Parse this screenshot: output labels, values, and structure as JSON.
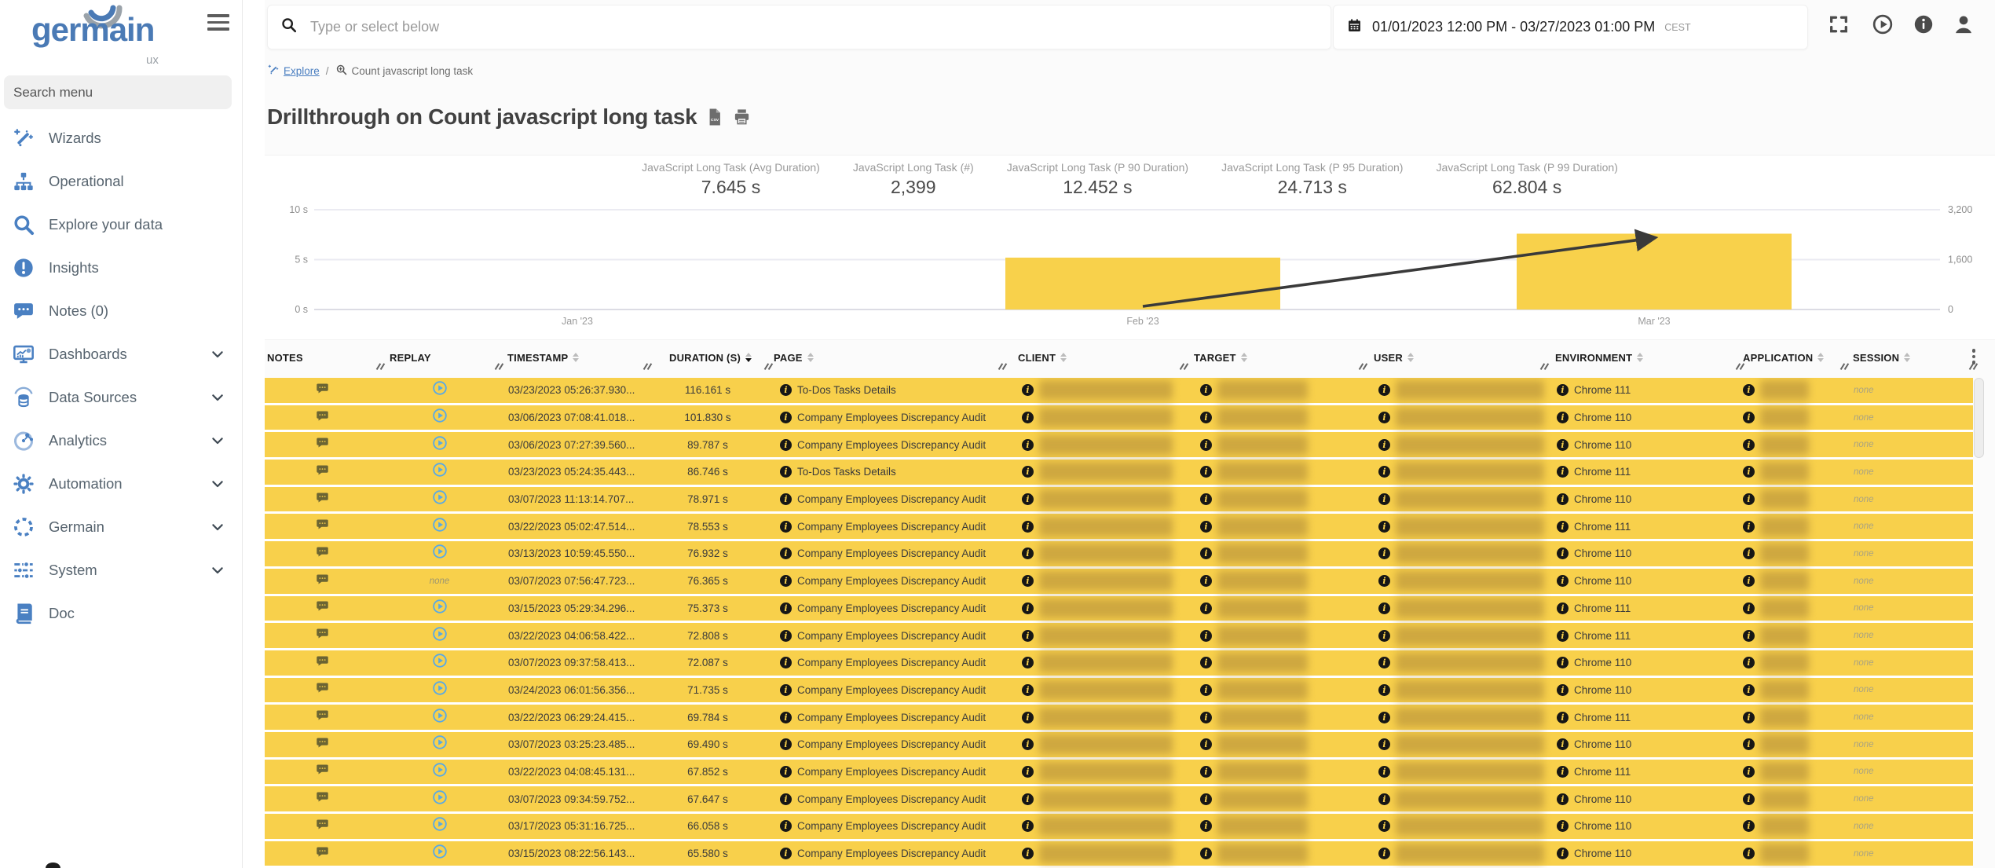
{
  "colors": {
    "accent": "#4a7ec0",
    "row_yellow": "#f8d04b",
    "bar_yellow": "#f8d14b",
    "replay_blue": "#57a9e7",
    "line_dark": "#3a3a3a"
  },
  "sidebar": {
    "logo": {
      "text": "germain",
      "sub": "ux"
    },
    "search_placeholder": "Search menu",
    "items": [
      {
        "label": "Wizards",
        "icon": "wand",
        "expandable": false
      },
      {
        "label": "Operational",
        "icon": "sitemap",
        "expandable": false
      },
      {
        "label": "Explore your data",
        "icon": "search",
        "expandable": false
      },
      {
        "label": "Insights",
        "icon": "exclamation-circle",
        "expandable": false
      },
      {
        "label": "Notes (0)",
        "icon": "comment",
        "expandable": false
      },
      {
        "label": "Dashboards",
        "icon": "monitor-chart",
        "expandable": true
      },
      {
        "label": "Data Sources",
        "icon": "database",
        "expandable": true
      },
      {
        "label": "Analytics",
        "icon": "analytics",
        "expandable": true
      },
      {
        "label": "Automation",
        "icon": "gear",
        "expandable": true
      },
      {
        "label": "Germain",
        "icon": "dashed-circle",
        "expandable": true
      },
      {
        "label": "System",
        "icon": "sliders",
        "expandable": true
      },
      {
        "label": "Doc",
        "icon": "book",
        "expandable": false
      }
    ]
  },
  "topbar": {
    "search_placeholder": "Type or select below",
    "date_range": "01/01/2023 12:00 PM - 03/27/2023 01:00 PM",
    "timezone": "CEST",
    "icons": [
      "calendar-icon",
      "fullscreen-icon",
      "play-circle-icon",
      "info-icon",
      "user-icon"
    ]
  },
  "breadcrumb": {
    "explore": "Explore",
    "separator": "/",
    "current": "Count javascript long task"
  },
  "page": {
    "title": "Drillthrough on Count javascript long task",
    "title_icons": [
      "csv-export-icon",
      "print-icon"
    ]
  },
  "metrics": [
    {
      "label": "JavaScript Long Task (Avg Duration)",
      "value": "7.645 s"
    },
    {
      "label": "JavaScript Long Task (#)",
      "value": "2,399"
    },
    {
      "label": "JavaScript Long Task (P 90 Duration)",
      "value": "12.452 s"
    },
    {
      "label": "JavaScript Long Task (P 95 Duration)",
      "value": "24.713 s"
    },
    {
      "label": "JavaScript Long Task (P 99 Duration)",
      "value": "62.804 s"
    }
  ],
  "chart_data": {
    "type": "bar+line",
    "x": [
      "Jan '23",
      "Feb '23",
      "Mar '23"
    ],
    "series": [
      {
        "name": "JavaScript Long Task (Avg Duration)",
        "type": "bar",
        "axis": "left",
        "color": "#f8d14b",
        "values": [
          null,
          5.2,
          7.6
        ]
      },
      {
        "name": "JavaScript Long Task (#)",
        "type": "line",
        "axis": "right",
        "color": "#3a3a3a",
        "values": [
          null,
          100,
          2300
        ]
      }
    ],
    "left_axis": {
      "ticks": [
        "0 s",
        "5 s",
        "10 s"
      ],
      "range": [
        0,
        10
      ]
    },
    "right_axis": {
      "ticks": [
        "0",
        "1,600",
        "3,200"
      ],
      "range": [
        0,
        3200
      ]
    },
    "grid": true,
    "legend": "none"
  },
  "table": {
    "columns": [
      {
        "label": "NOTES",
        "sortable": false,
        "sort": "none"
      },
      {
        "label": "REPLAY",
        "sortable": false,
        "sort": "none"
      },
      {
        "label": "TIMESTAMP",
        "sortable": true,
        "sort": "none"
      },
      {
        "label": "DURATION (S)",
        "sortable": true,
        "sort": "desc"
      },
      {
        "label": "PAGE",
        "sortable": true,
        "sort": "none"
      },
      {
        "label": "CLIENT",
        "sortable": true,
        "sort": "none"
      },
      {
        "label": "TARGET",
        "sortable": true,
        "sort": "none"
      },
      {
        "label": "USER",
        "sortable": true,
        "sort": "none"
      },
      {
        "label": "ENVIRONMENT",
        "sortable": true,
        "sort": "none"
      },
      {
        "label": "APPLICATION",
        "sortable": true,
        "sort": "none"
      },
      {
        "label": "SESSION",
        "sortable": true,
        "sort": "none"
      }
    ],
    "redacted_columns": [
      "CLIENT",
      "TARGET",
      "USER",
      "APPLICATION"
    ],
    "rows": [
      {
        "replay": "play",
        "timestamp": "03/23/2023 05:26:37.930...",
        "duration": "116.161 s",
        "page": "To-Dos Tasks Details",
        "environment": "Chrome 111",
        "session": "none"
      },
      {
        "replay": "play",
        "timestamp": "03/06/2023 07:08:41.018...",
        "duration": "101.830 s",
        "page": "Company Employees Discrepancy Audit",
        "environment": "Chrome 110",
        "session": "none"
      },
      {
        "replay": "play",
        "timestamp": "03/06/2023 07:27:39.560...",
        "duration": "89.787 s",
        "page": "Company Employees Discrepancy Audit",
        "environment": "Chrome 110",
        "session": "none"
      },
      {
        "replay": "play",
        "timestamp": "03/23/2023 05:24:35.443...",
        "duration": "86.746 s",
        "page": "To-Dos Tasks Details",
        "environment": "Chrome 111",
        "session": "none"
      },
      {
        "replay": "play",
        "timestamp": "03/07/2023 11:13:14.707...",
        "duration": "78.971 s",
        "page": "Company Employees Discrepancy Audit",
        "environment": "Chrome 110",
        "session": "none"
      },
      {
        "replay": "play",
        "timestamp": "03/22/2023 05:02:47.514...",
        "duration": "78.553 s",
        "page": "Company Employees Discrepancy Audit",
        "environment": "Chrome 111",
        "session": "none"
      },
      {
        "replay": "play",
        "timestamp": "03/13/2023 10:59:45.550...",
        "duration": "76.932 s",
        "page": "Company Employees Discrepancy Audit",
        "environment": "Chrome 110",
        "session": "none"
      },
      {
        "replay": "none",
        "timestamp": "03/07/2023 07:56:47.723...",
        "duration": "76.365 s",
        "page": "Company Employees Discrepancy Audit",
        "environment": "Chrome 110",
        "session": "none"
      },
      {
        "replay": "play",
        "timestamp": "03/15/2023 05:29:34.296...",
        "duration": "75.373 s",
        "page": "Company Employees Discrepancy Audit",
        "environment": "Chrome 111",
        "session": "none"
      },
      {
        "replay": "play",
        "timestamp": "03/22/2023 04:06:58.422...",
        "duration": "72.808 s",
        "page": "Company Employees Discrepancy Audit",
        "environment": "Chrome 111",
        "session": "none"
      },
      {
        "replay": "play",
        "timestamp": "03/07/2023 09:37:58.413...",
        "duration": "72.087 s",
        "page": "Company Employees Discrepancy Audit",
        "environment": "Chrome 110",
        "session": "none"
      },
      {
        "replay": "play",
        "timestamp": "03/24/2023 06:01:56.356...",
        "duration": "71.735 s",
        "page": "Company Employees Discrepancy Audit",
        "environment": "Chrome 110",
        "session": "none"
      },
      {
        "replay": "play",
        "timestamp": "03/22/2023 06:29:24.415...",
        "duration": "69.784 s",
        "page": "Company Employees Discrepancy Audit",
        "environment": "Chrome 111",
        "session": "none"
      },
      {
        "replay": "play",
        "timestamp": "03/07/2023 03:25:23.485...",
        "duration": "69.490 s",
        "page": "Company Employees Discrepancy Audit",
        "environment": "Chrome 110",
        "session": "none"
      },
      {
        "replay": "play",
        "timestamp": "03/22/2023 04:08:45.131...",
        "duration": "67.852 s",
        "page": "Company Employees Discrepancy Audit",
        "environment": "Chrome 111",
        "session": "none"
      },
      {
        "replay": "play",
        "timestamp": "03/07/2023 09:34:59.752...",
        "duration": "67.647 s",
        "page": "Company Employees Discrepancy Audit",
        "environment": "Chrome 110",
        "session": "none"
      },
      {
        "replay": "play",
        "timestamp": "03/17/2023 05:31:16.725...",
        "duration": "66.058 s",
        "page": "Company Employees Discrepancy Audit",
        "environment": "Chrome 110",
        "session": "none"
      },
      {
        "replay": "play",
        "timestamp": "03/15/2023 08:22:56.143...",
        "duration": "65.580 s",
        "page": "Company Employees Discrepancy Audit",
        "environment": "Chrome 110",
        "session": "none"
      }
    ]
  }
}
